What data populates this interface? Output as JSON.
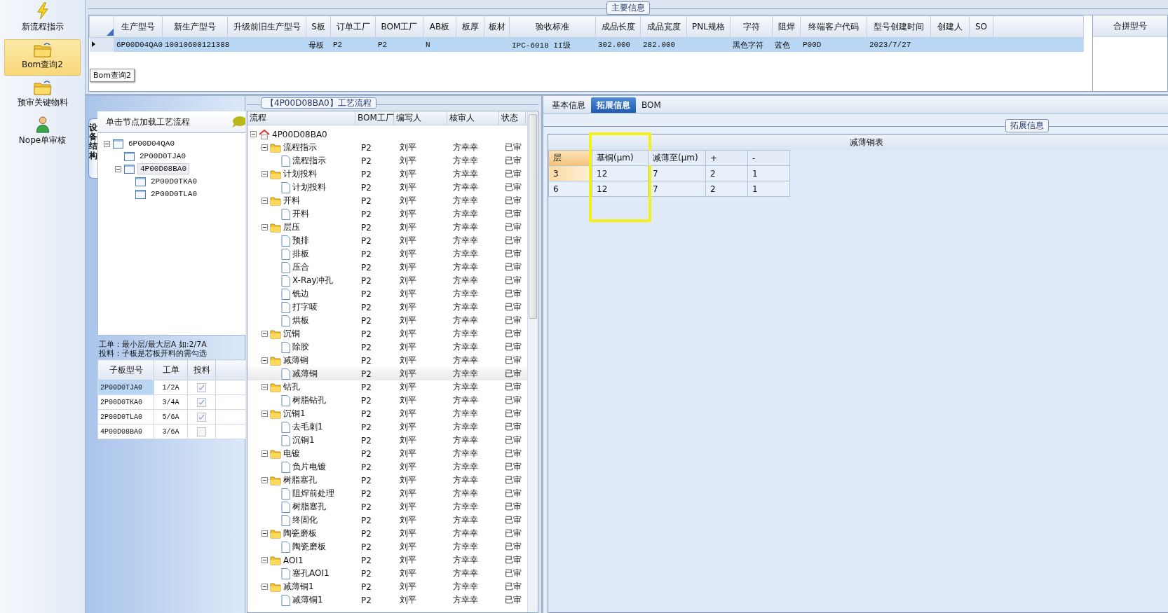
{
  "nav": {
    "items": [
      {
        "label": "新流程指示",
        "kind": "bolt",
        "selected": false
      },
      {
        "label": "Bom查询2",
        "kind": "folder",
        "selected": true
      },
      {
        "label": "预审关键物料",
        "kind": "folder",
        "selected": false
      },
      {
        "label": "Nope单审核",
        "kind": "person",
        "selected": false
      }
    ],
    "tooltip": "Bom查询2"
  },
  "main_info": {
    "title": "主要信息",
    "columns": [
      "生产型号",
      "新生产型号",
      "升级前旧生产型号",
      "S板",
      "订单工厂",
      "BOM工厂",
      "AB板",
      "板厚",
      "板材",
      "验收标准",
      "成品长度",
      "成品宽度",
      "PNL规格",
      "字符",
      "阻焊",
      "终端客户代码",
      "型号创建时间",
      "创建人",
      "SO"
    ],
    "rows": [
      {
        "selected": true,
        "cells": [
          "6P00D04QA0",
          "10010600121388",
          null,
          "母板",
          "P2",
          "P2",
          "N",
          null,
          null,
          "IPC-6018 II级",
          "302.000",
          "282.000",
          null,
          "黑色字符",
          "蓝色",
          "P00D",
          "2023/7/27",
          null,
          null
        ]
      }
    ],
    "side_column": "合拼型号"
  },
  "structure": {
    "tab": "设备结构",
    "hint": "单击节点加载工艺流程",
    "tree": [
      {
        "label": "6P00D04QA0",
        "expanded": true,
        "selected": false,
        "children": [
          {
            "label": "2P00D0TJA0",
            "selected": false
          },
          {
            "label": "4P00D08BA0",
            "expanded": true,
            "selected": true,
            "children": [
              {
                "label": "2P00D0TKA0",
                "selected": false
              },
              {
                "label": "2P00D0TLA0",
                "selected": false
              }
            ]
          }
        ]
      }
    ],
    "notes": [
      "工单：最小层/最大层A 如:2/7A",
      "投料：子板是芯板开料的需勾选"
    ],
    "sub_columns": [
      "子板型号",
      "工单",
      "投料"
    ],
    "sub_rows": [
      {
        "board": "2P00D0TJA0",
        "order": "1/2A",
        "checked": true,
        "selected": true
      },
      {
        "board": "2P00D0TKA0",
        "order": "3/4A",
        "checked": true,
        "selected": false
      },
      {
        "board": "2P00D0TLA0",
        "order": "5/6A",
        "checked": true,
        "selected": false
      },
      {
        "board": "4P00D08BA0",
        "order": "3/6A",
        "checked": false,
        "selected": false
      }
    ]
  },
  "process": {
    "title": "【4P00D08BA0】工艺流程",
    "columns": [
      "流程",
      "BOM工厂",
      "编写人",
      "核审人",
      "状态"
    ],
    "tree": [
      {
        "label": "4P00D08BA0",
        "kind": "root",
        "expanded": true,
        "selected": false,
        "children": [
          {
            "label": "流程指示",
            "kind": "group",
            "expanded": true,
            "selected": false,
            "bom": "P2",
            "writer": "刘平",
            "reviewer": "方幸幸",
            "status": "已审",
            "children": [
              {
                "label": "流程指示",
                "kind": "step",
                "selected": false,
                "bom": "P2",
                "writer": "刘平",
                "reviewer": "方幸幸",
                "status": "已审"
              }
            ]
          },
          {
            "label": "计划投料",
            "kind": "group",
            "expanded": true,
            "selected": false,
            "bom": "P2",
            "writer": "刘平",
            "reviewer": "方幸幸",
            "status": "已审",
            "children": [
              {
                "label": "计划投料",
                "kind": "step",
                "selected": false,
                "bom": "P2",
                "writer": "刘平",
                "reviewer": "方幸幸",
                "status": "已审"
              }
            ]
          },
          {
            "label": "开料",
            "kind": "group",
            "expanded": true,
            "selected": false,
            "bom": "P2",
            "writer": "刘平",
            "reviewer": "方幸幸",
            "status": "已审",
            "children": [
              {
                "label": "开料",
                "kind": "step",
                "selected": false,
                "bom": "P2",
                "writer": "刘平",
                "reviewer": "方幸幸",
                "status": "已审"
              }
            ]
          },
          {
            "label": "层压",
            "kind": "group",
            "expanded": true,
            "selected": false,
            "bom": "P2",
            "writer": "刘平",
            "reviewer": "方幸幸",
            "status": "已审",
            "children": [
              {
                "label": "预排",
                "kind": "step",
                "selected": false,
                "bom": "P2",
                "writer": "刘平",
                "reviewer": "方幸幸",
                "status": "已审"
              },
              {
                "label": "排板",
                "kind": "step",
                "selected": false,
                "bom": "P2",
                "writer": "刘平",
                "reviewer": "方幸幸",
                "status": "已审"
              },
              {
                "label": "压合",
                "kind": "step",
                "selected": false,
                "bom": "P2",
                "writer": "刘平",
                "reviewer": "方幸幸",
                "status": "已审"
              },
              {
                "label": "X-Ray冲孔",
                "kind": "step",
                "selected": false,
                "bom": "P2",
                "writer": "刘平",
                "reviewer": "方幸幸",
                "status": "已审"
              },
              {
                "label": "铣边",
                "kind": "step",
                "selected": false,
                "bom": "P2",
                "writer": "刘平",
                "reviewer": "方幸幸",
                "status": "已审"
              },
              {
                "label": "打字唛",
                "kind": "step",
                "selected": false,
                "bom": "P2",
                "writer": "刘平",
                "reviewer": "方幸幸",
                "status": "已审"
              },
              {
                "label": "烘板",
                "kind": "step",
                "selected": false,
                "bom": "P2",
                "writer": "刘平",
                "reviewer": "方幸幸",
                "status": "已审"
              }
            ]
          },
          {
            "label": "沉铜",
            "kind": "group",
            "expanded": true,
            "selected": false,
            "bom": "P2",
            "writer": "刘平",
            "reviewer": "方幸幸",
            "status": "已审",
            "children": [
              {
                "label": "除胶",
                "kind": "step",
                "selected": false,
                "bom": "P2",
                "writer": "刘平",
                "reviewer": "方幸幸",
                "status": "已审"
              }
            ]
          },
          {
            "label": "减薄铜",
            "kind": "group",
            "expanded": true,
            "selected": false,
            "bom": "P2",
            "writer": "刘平",
            "reviewer": "方幸幸",
            "status": "已审",
            "children": [
              {
                "label": "减薄铜",
                "kind": "step",
                "selected": true,
                "bom": "P2",
                "writer": "刘平",
                "reviewer": "方幸幸",
                "status": "已审"
              }
            ]
          },
          {
            "label": "钻孔",
            "kind": "group",
            "expanded": true,
            "selected": false,
            "bom": "P2",
            "writer": "刘平",
            "reviewer": "方幸幸",
            "status": "已审",
            "children": [
              {
                "label": "树脂钻孔",
                "kind": "step",
                "selected": false,
                "bom": "P2",
                "writer": "刘平",
                "reviewer": "方幸幸",
                "status": "已审"
              }
            ]
          },
          {
            "label": "沉铜1",
            "kind": "group",
            "expanded": true,
            "selected": false,
            "bom": "P2",
            "writer": "刘平",
            "reviewer": "方幸幸",
            "status": "已审",
            "children": [
              {
                "label": "去毛刺1",
                "kind": "step",
                "selected": false,
                "bom": "P2",
                "writer": "刘平",
                "reviewer": "方幸幸",
                "status": "已审"
              },
              {
                "label": "沉铜1",
                "kind": "step",
                "selected": false,
                "bom": "P2",
                "writer": "刘平",
                "reviewer": "方幸幸",
                "status": "已审"
              }
            ]
          },
          {
            "label": "电镀",
            "kind": "group",
            "expanded": true,
            "selected": false,
            "bom": "P2",
            "writer": "刘平",
            "reviewer": "方幸幸",
            "status": "已审",
            "children": [
              {
                "label": "负片电镀",
                "kind": "step",
                "selected": false,
                "bom": "P2",
                "writer": "刘平",
                "reviewer": "方幸幸",
                "status": "已审"
              }
            ]
          },
          {
            "label": "树脂塞孔",
            "kind": "group",
            "expanded": true,
            "selected": false,
            "bom": "P2",
            "writer": "刘平",
            "reviewer": "方幸幸",
            "status": "已审",
            "children": [
              {
                "label": "阻焊前处理",
                "kind": "step",
                "selected": false,
                "bom": "P2",
                "writer": "刘平",
                "reviewer": "方幸幸",
                "status": "已审"
              },
              {
                "label": "树脂塞孔",
                "kind": "step",
                "selected": false,
                "bom": "P2",
                "writer": "刘平",
                "reviewer": "方幸幸",
                "status": "已审"
              },
              {
                "label": "终固化",
                "kind": "step",
                "selected": false,
                "bom": "P2",
                "writer": "刘平",
                "reviewer": "方幸幸",
                "status": "已审"
              }
            ]
          },
          {
            "label": "陶瓷磨板",
            "kind": "group",
            "expanded": true,
            "selected": false,
            "bom": "P2",
            "writer": "刘平",
            "reviewer": "方幸幸",
            "status": "已审",
            "children": [
              {
                "label": "陶瓷磨板",
                "kind": "step",
                "selected": false,
                "bom": "P2",
                "writer": "刘平",
                "reviewer": "方幸幸",
                "status": "已审"
              }
            ]
          },
          {
            "label": "AOI1",
            "kind": "group",
            "expanded": true,
            "selected": false,
            "bom": "P2",
            "writer": "刘平",
            "reviewer": "方幸幸",
            "status": "已审",
            "children": [
              {
                "label": "塞孔AOI1",
                "kind": "step",
                "selected": false,
                "bom": "P2",
                "writer": "刘平",
                "reviewer": "方幸幸",
                "status": "已审"
              }
            ]
          },
          {
            "label": "减薄铜1",
            "kind": "group",
            "expanded": true,
            "selected": false,
            "bom": "P2",
            "writer": "刘平",
            "reviewer": "方幸幸",
            "status": "已审",
            "children": [
              {
                "label": "减薄铜1",
                "kind": "step",
                "selected": false,
                "bom": "P2",
                "writer": "刘平",
                "reviewer": "方幸幸",
                "status": "已审"
              }
            ]
          }
        ]
      }
    ]
  },
  "detail": {
    "tabs": [
      {
        "label": "基本信息",
        "selected": false
      },
      {
        "label": "拓展信息",
        "selected": true
      },
      {
        "label": "BOM",
        "selected": false
      }
    ],
    "group_title": "拓展信息",
    "table_title": "减薄铜表",
    "columns": [
      {
        "label": "层",
        "highlighted": false
      },
      {
        "label": "基铜(μm)",
        "highlighted": true
      },
      {
        "label": "减薄至(μm)",
        "highlighted": false
      },
      {
        "label": "+",
        "highlighted": false
      },
      {
        "label": "-",
        "highlighted": false
      }
    ],
    "rows": [
      {
        "selected": true,
        "cells": [
          "3",
          "12",
          "7",
          "2",
          "1"
        ]
      },
      {
        "selected": false,
        "cells": [
          "6",
          "12",
          "7",
          "2",
          "1"
        ]
      }
    ]
  }
}
